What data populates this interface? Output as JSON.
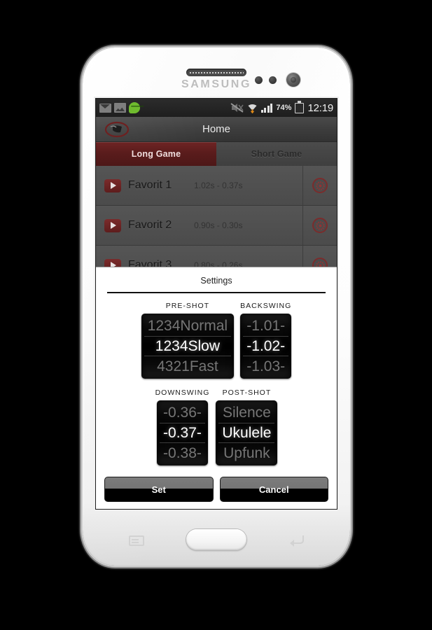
{
  "device": {
    "brand": "SAMSUNG"
  },
  "status_bar": {
    "notifications": [
      "mail-icon",
      "image-icon",
      "chat-icon"
    ],
    "mute_icon": "mute-icon",
    "wifi_icon": "wifi-icon",
    "signal_icon": "signal-bars-icon",
    "battery_percent": "74%",
    "battery_icon": "battery-icon",
    "battery_color": "#7ddf2a",
    "clock": "12:19"
  },
  "action_bar": {
    "logo": "app-logo-icon",
    "title": "Home"
  },
  "tabs": [
    {
      "label": "Long Game",
      "active": true
    },
    {
      "label": "Short Game",
      "active": false
    }
  ],
  "favorites": [
    {
      "play": "play-icon",
      "name": "Favorit 1",
      "times": "1.02s - 0.37s",
      "gear": "gear-icon"
    },
    {
      "play": "play-icon",
      "name": "Favorit 2",
      "times": "0.90s - 0.30s",
      "gear": "gear-icon"
    },
    {
      "play": "play-icon",
      "name": "Favorit 3",
      "times": "0.80s - 0.26s",
      "gear": "gear-icon"
    }
  ],
  "dialog": {
    "title": "Settings",
    "pickers": [
      {
        "label": "PRE-SHOT",
        "above": "1234Normal",
        "selected": "1234Slow",
        "below": "4321Fast"
      },
      {
        "label": "BACKSWING",
        "above": "-1.01-",
        "selected": "-1.02-",
        "below": "-1.03-"
      },
      {
        "label": "DOWNSWING",
        "above": "-0.36-",
        "selected": "-0.37-",
        "below": "-0.38-"
      },
      {
        "label": "POST-SHOT",
        "above": "Silence",
        "selected": "Ukulele",
        "below": "Upfunk"
      }
    ],
    "set_label": "Set",
    "cancel_label": "Cancel"
  },
  "colors": {
    "accent_red": "#5a1c1c",
    "battery_green": "#7ddf2a",
    "screen_gray": "#4b4b4b"
  }
}
